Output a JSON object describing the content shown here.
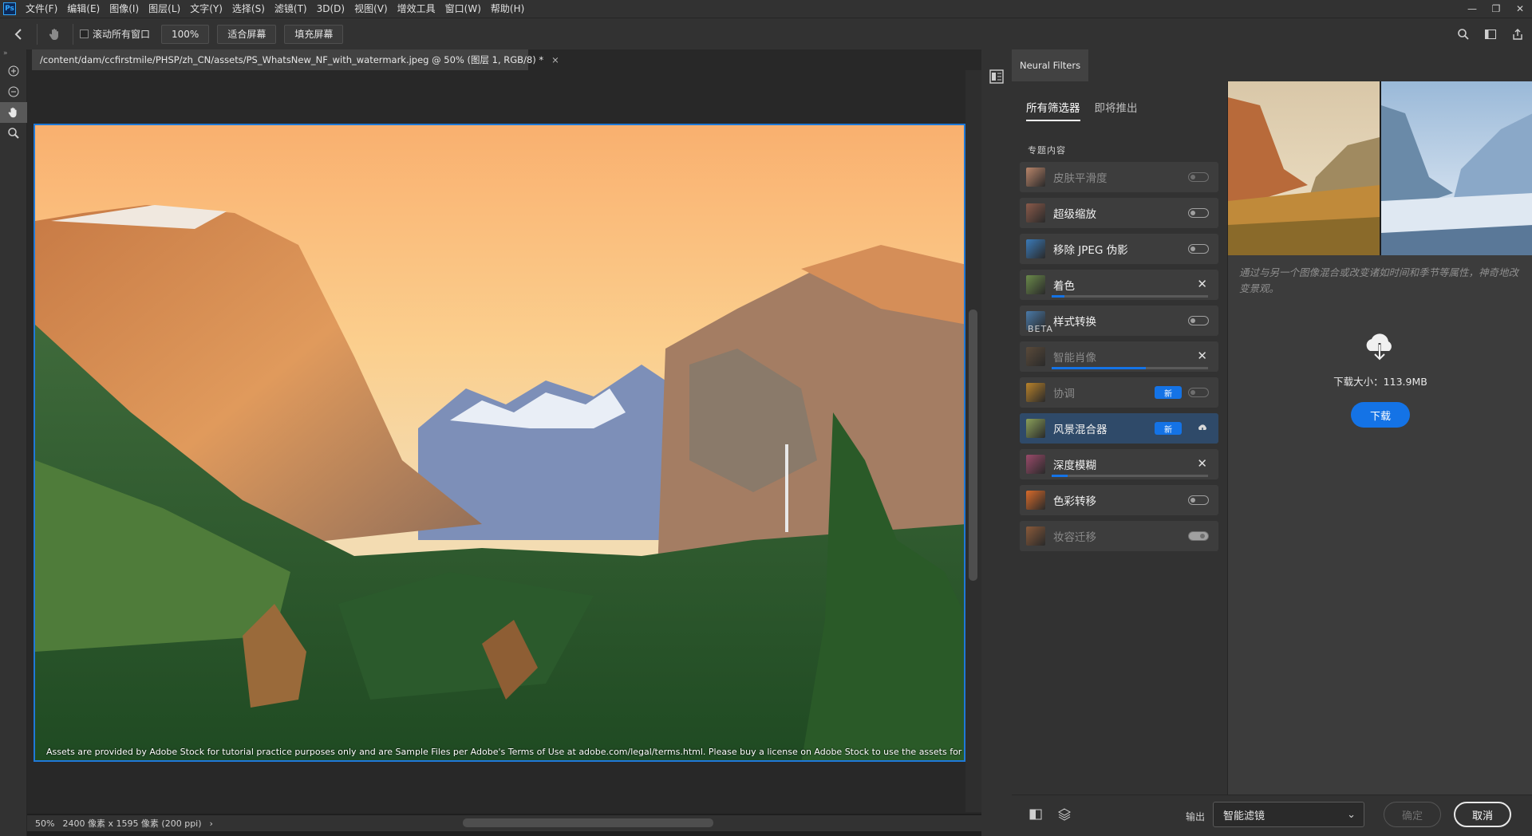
{
  "app": {
    "logo_text": "Ps"
  },
  "menu": [
    "文件(F)",
    "编辑(E)",
    "图像(I)",
    "图层(L)",
    "文字(Y)",
    "选择(S)",
    "滤镜(T)",
    "3D(D)",
    "视图(V)",
    "增效工具",
    "窗口(W)",
    "帮助(H)"
  ],
  "options": {
    "scroll_all_label": "滚动所有窗口",
    "zoom_value": "100%",
    "fit_screen": "适合屏幕",
    "fill_screen": "填充屏幕"
  },
  "document": {
    "tab_title": "/content/dam/ccfirstmile/PHSP/zh_CN/assets/PS_WhatsNew_NF_with_watermark.jpeg @ 50% (图层 1, RGB/8) *",
    "watermark": "Assets are provided by Adobe Stock for tutorial practice purposes only and are Sample Files per Adobe's Terms of Use at adobe.com/legal/terms.html. Please buy a license on Adobe Stock to use the assets for other purposes.",
    "zoom": "50%",
    "dims": "2400 像素 x 1595 像素 (200 ppi)"
  },
  "neural": {
    "panel_title": "Neural Filters",
    "tab_all": "所有筛选器",
    "tab_coming": "即将推出",
    "section_featured": "专题内容",
    "section_beta": "BETA",
    "new_badge": "新",
    "featured": [
      {
        "name": "皮肤平滑度",
        "state": "toggle",
        "dim": true
      },
      {
        "name": "超级缩放",
        "state": "toggle"
      },
      {
        "name": "移除 JPEG 伪影",
        "state": "toggle"
      },
      {
        "name": "着色",
        "state": "progress",
        "progress": 0.08
      },
      {
        "name": "样式转换",
        "state": "toggle"
      }
    ],
    "beta": [
      {
        "name": "智能肖像",
        "state": "progress",
        "progress": 0.6,
        "dim": true
      },
      {
        "name": "协调",
        "state": "new-toggle",
        "dim": true
      },
      {
        "name": "风景混合器",
        "state": "new-cloud",
        "selected": true
      },
      {
        "name": "深度模糊",
        "state": "progress",
        "progress": 0.1
      },
      {
        "name": "色彩转移",
        "state": "toggle"
      },
      {
        "name": "妆容迁移",
        "state": "toggle-on",
        "dim": true
      }
    ],
    "description": "通过与另一个图像混合或改变诸如时间和季节等属性，神奇地改变景观。",
    "download_size": "下载大小：113.9MB",
    "download_label": "下载",
    "output_label": "输出",
    "output_value": "智能滤镜",
    "ok_label": "确定",
    "cancel_label": "取消"
  },
  "colors": {
    "accent": "#1473e6",
    "panel": "#323232",
    "selection": "#2f4a69"
  }
}
